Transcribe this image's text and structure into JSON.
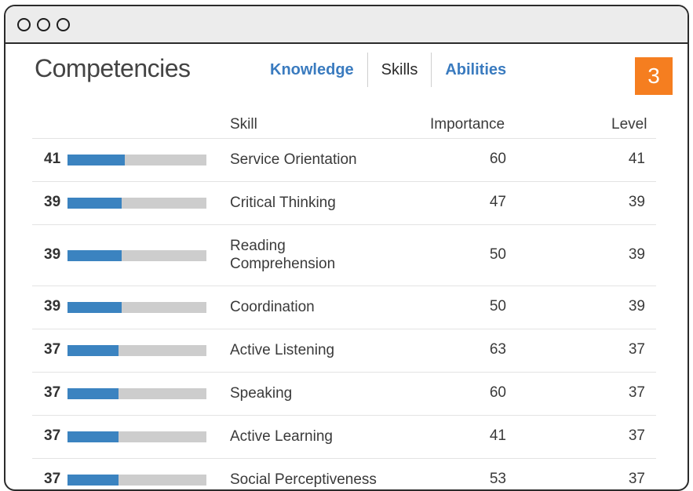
{
  "window": {
    "controls": [
      "close",
      "minimize",
      "maximize"
    ]
  },
  "page": {
    "title": "Competencies",
    "badge": "3"
  },
  "tabs": [
    {
      "label": "Knowledge",
      "active": false
    },
    {
      "label": "Skills",
      "active": true
    },
    {
      "label": "Abilities",
      "active": false
    }
  ],
  "table": {
    "columns": {
      "skill": "Skill",
      "importance": "Importance",
      "level": "Level"
    },
    "rows": [
      {
        "score": "41",
        "bar_fraction": 0.41,
        "skill": "Service Orientation",
        "importance": "60",
        "level": "41"
      },
      {
        "score": "39",
        "bar_fraction": 0.39,
        "skill": "Critical Thinking",
        "importance": "47",
        "level": "39"
      },
      {
        "score": "39",
        "bar_fraction": 0.39,
        "skill": "Reading Comprehension",
        "importance": "50",
        "level": "39"
      },
      {
        "score": "39",
        "bar_fraction": 0.39,
        "skill": "Coordination",
        "importance": "50",
        "level": "39"
      },
      {
        "score": "37",
        "bar_fraction": 0.37,
        "skill": "Active Listening",
        "importance": "63",
        "level": "37"
      },
      {
        "score": "37",
        "bar_fraction": 0.37,
        "skill": "Speaking",
        "importance": "60",
        "level": "37"
      },
      {
        "score": "37",
        "bar_fraction": 0.37,
        "skill": "Active Learning",
        "importance": "41",
        "level": "37"
      },
      {
        "score": "37",
        "bar_fraction": 0.37,
        "skill": "Social Perceptiveness",
        "importance": "53",
        "level": "37"
      }
    ]
  },
  "colors": {
    "accent": "#3a7bbf",
    "bar_fill": "#3b83c0",
    "bar_track": "#cdcdcd",
    "badge": "#f57e20"
  }
}
